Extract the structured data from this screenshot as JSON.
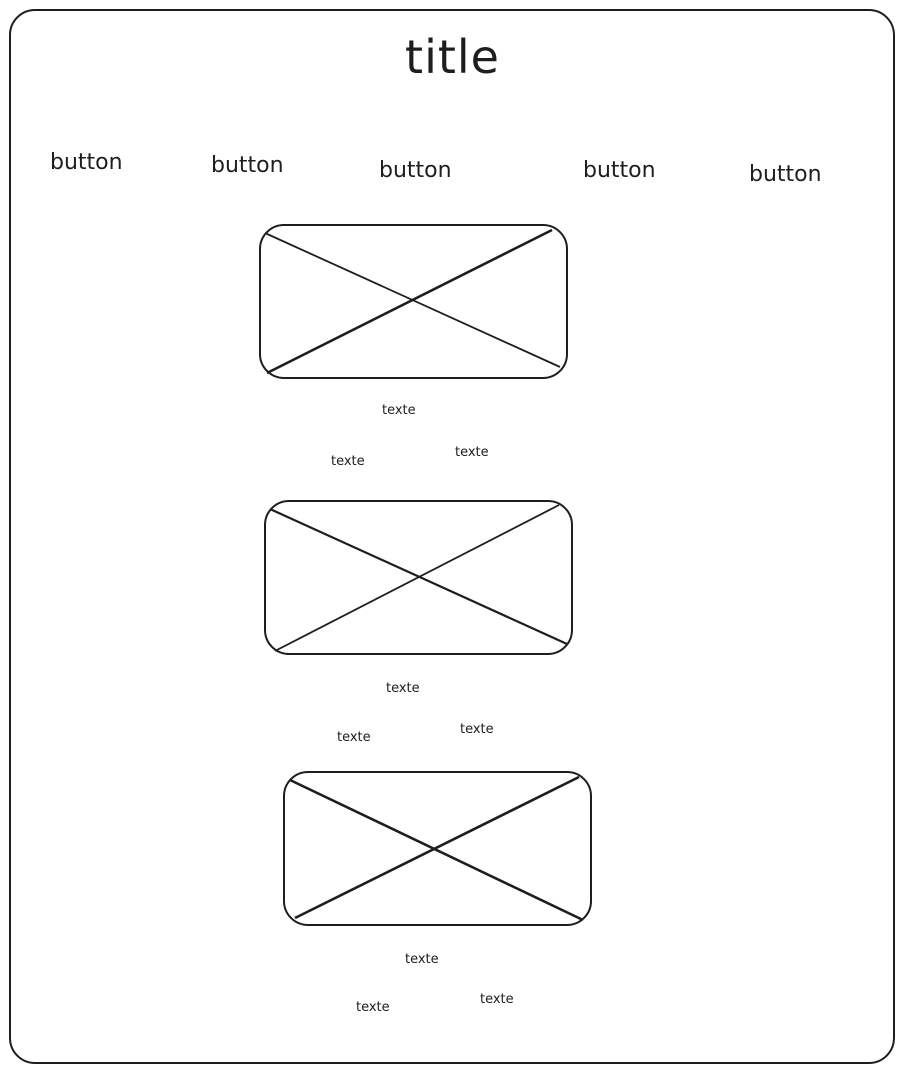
{
  "title": "title",
  "nav": {
    "buttons": [
      "button",
      "button",
      "button",
      "button",
      "button"
    ]
  },
  "cards": [
    {
      "texts": [
        "texte",
        "texte",
        "texte"
      ]
    },
    {
      "texts": [
        "texte",
        "texte",
        "texte"
      ]
    },
    {
      "texts": [
        "texte",
        "texte",
        "texte"
      ]
    }
  ],
  "colors": {
    "stroke": "#1e1e1e",
    "background": "#ffffff"
  }
}
